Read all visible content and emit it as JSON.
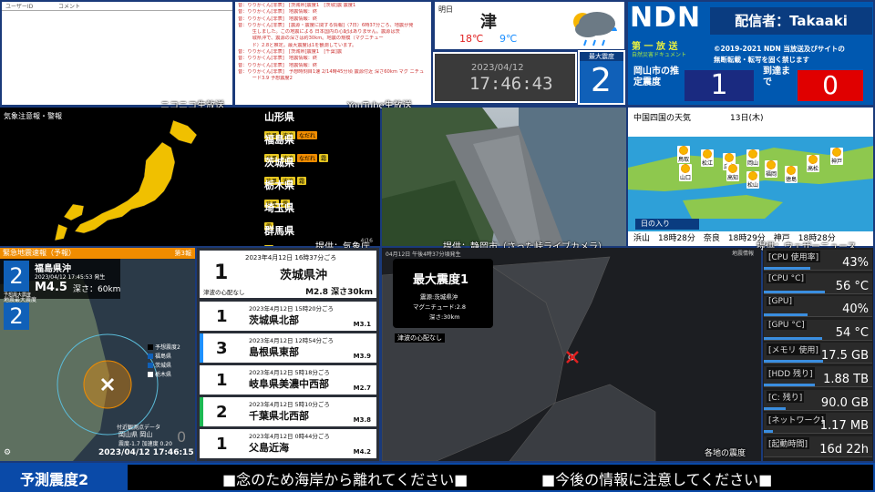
{
  "comments": {
    "col_user": "ユーザーID",
    "col_comment": "コメント"
  },
  "youtube_feed": [
    "音：りりかくん[非表]　[茨城県]震度1　[茨城]震 震度1",
    "音：りりかくん[非表]　地震情報：終",
    "音：りりかくん[非表]　地震情報：終",
    "音：りりかくん[非表]　[震源・震度に関する情報]（7日）6時37分ごろ、地震が発",
    "　　　生しました。この地震による 日本国内の心配はありません。震源は茨",
    "　　　城県沖で、震源の深さは約30km。地震の規模（マグニチュー",
    "　　　ド）2.8と推定。最大震度は1を観測しています。",
    "音：りりかくん[非表]　[茨城県]震度1　[千葉]震",
    "音：りりかくん[非表]　地震情報：終",
    "音：りりかくん[非表]　地震情報：終",
    "音：りりかくん[非表]　予想時刻目1速 2/14時45分頃 震源付近 深さ60km マグ ニチュ",
    "　　　ード3.9 予想震度2"
  ],
  "weather": {
    "day": "明日",
    "city": "津",
    "high": "18℃",
    "low": "9℃"
  },
  "clock": {
    "date": "2023/04/12",
    "time": "17:46:43"
  },
  "max_shindo_box": {
    "label": "最大震度",
    "value": "2"
  },
  "ndn": {
    "logo": "NDN",
    "streamer": "配信者：Takaaki",
    "dai": "第 一 放 送",
    "sub": "自然災害ドキュメント",
    "copyright": "©2019-2021 NDN 当放送及びサイトの",
    "copyright2": "無断転載・転写を固く禁じます",
    "okayama_label": "岡山市の推定震度",
    "okayama_value": "1",
    "arrival_label": "到達まで",
    "arrival_value": "0"
  },
  "overlay": {
    "niconico": "ニコニコ生放送",
    "youtube": "YouTube生放送",
    "credit_jma": "提供：気象庁",
    "credit_shizuoka": "提供：静岡市（さった峠ライブカメラ）",
    "credit_wn": "提供：ウェザーニュース"
  },
  "warnings": {
    "title": "気象注意報・警報",
    "prefs": [
      {
        "name": "山形県",
        "tags": [
          "強風",
          "波浪",
          "なだれ"
        ]
      },
      {
        "name": "福島県",
        "tags": [
          "強風",
          "波浪",
          "なだれ",
          "霜"
        ]
      },
      {
        "name": "茨城県",
        "tags": [
          "強風",
          "波浪",
          "霜"
        ]
      },
      {
        "name": "栃木県",
        "tags": [
          "強風",
          "霜"
        ]
      },
      {
        "name": "埼玉県",
        "tags": [
          "霜"
        ]
      },
      {
        "name": "群馬県",
        "tags": [
          "霜"
        ]
      }
    ],
    "page": "4/16"
  },
  "forecast": {
    "title": "中国四国の天気",
    "date": "13日(木)",
    "cities": [
      "鳥取",
      "松江",
      "広島",
      "岡山",
      "山口",
      "高知",
      "松山",
      "福岡",
      "徳島",
      "高松",
      "神戸"
    ],
    "sunset_label": "日の入り",
    "sunset": "浜山　18時28分　奈良　18時29分　神戸　18時28分"
  },
  "eew": {
    "header": "緊急地震速報（予報）",
    "report": "第3報",
    "shindo_label": "予想最大震度",
    "shindo": "2",
    "place": "福島県沖",
    "time": "2023/04/12 17:45:53 発生",
    "mag": "M4.5",
    "depth": "深さ：60km",
    "obs_label": "地震最大震度",
    "obs": "2",
    "legend": [
      "予想震度2",
      "福島県",
      "茨城県",
      "栃木県"
    ],
    "note": "付近観測点データ",
    "station": "岡山県 岡山",
    "data": "震度-1.7 加速度 0.20",
    "zero": "0",
    "stamp": "2023/04/12 17:46:15"
  },
  "eqlist": {
    "top": {
      "time": "2023年4月12日 16時37分ごろ",
      "shindo": "1",
      "place": "茨城県沖",
      "tsunami": "津波の心配なし",
      "mag": "M2.8 深さ30km"
    },
    "rows": [
      {
        "time": "2023年4月12日 15時20分ごろ",
        "shindo": "1",
        "place": "茨城県北部",
        "mag": "M3.1"
      },
      {
        "time": "2023年4月12日 12時54分ごろ",
        "shindo": "3",
        "place": "島根県東部",
        "mag": "M3.9"
      },
      {
        "time": "2023年4月12日 5時18分ごろ",
        "shindo": "1",
        "place": "岐阜県美濃中西部",
        "mag": "M2.7"
      },
      {
        "time": "2023年4月12日 5時10分ごろ",
        "shindo": "2",
        "place": "千葉県北西部",
        "mag": "M3.8"
      },
      {
        "time": "2023年4月12日 0時44分ごろ",
        "shindo": "1",
        "place": "父島近海",
        "mag": "M4.2"
      }
    ]
  },
  "emap": {
    "header": "04月12日 午後4時37分頃発生",
    "badge": "地震情報",
    "max": "最大震度1",
    "epi": "震源:茨城県沖",
    "mag": "マグニチュード:2.8",
    "depth": "深さ:30km",
    "tsunami": "津波の心配なし",
    "legend": "各地の震度"
  },
  "sys": [
    {
      "label": "[CPU 使用率]",
      "value": "43%",
      "pct": 43
    },
    {
      "label": "[CPU °C]",
      "value": "56 °C",
      "pct": 56
    },
    {
      "label": "[GPU]",
      "value": "40%",
      "pct": 40
    },
    {
      "label": "[GPU °C]",
      "value": "54 °C",
      "pct": 54
    },
    {
      "label": "[メモリ 使用]",
      "value": "17.5 GB",
      "pct": 55
    },
    {
      "label": "[HDD 残り]",
      "value": "1.88 TB",
      "pct": 47
    },
    {
      "label": "[C: 残り]",
      "value": "90.0 GB",
      "pct": 20
    },
    {
      "label": "[ネットワーク]",
      "value": "1.17 MB",
      "pct": 8
    },
    {
      "label": "[起動時間]",
      "value": "16d 22h",
      "pct": 0
    }
  ],
  "bottom": {
    "forecast": "予測震度2",
    "msg1": "■念のため海岸から離れてください■",
    "msg2": "■今後の情報に注意してください■"
  }
}
